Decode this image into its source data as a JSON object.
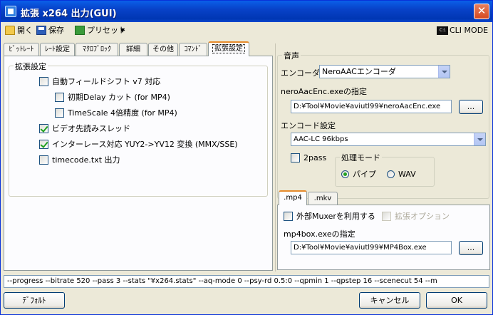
{
  "window": {
    "title": "拡張 x264 出力(GUI)"
  },
  "toolbar": {
    "open_label": "開く",
    "save_label": "保存",
    "preset_label": "プリセット",
    "cli_mode_label": "CLI MODE"
  },
  "tabs": [
    {
      "label": "ﾋﾞｯﾄﾚｰﾄ"
    },
    {
      "label": "ﾚｰﾄ設定"
    },
    {
      "label": "ﾏｸﾛﾌﾞﾛｯｸ"
    },
    {
      "label": "詳細"
    },
    {
      "label": "その他"
    },
    {
      "label": "ｺﾏﾝﾄﾞ"
    },
    {
      "label": "拡張設定"
    }
  ],
  "extended": {
    "group_title": "拡張設定",
    "options": [
      {
        "label": "自動フィールドシフト v7 対応",
        "checked": false
      },
      {
        "label": "初期Delay カット (for MP4)",
        "checked": false
      },
      {
        "label": "TimeScale 4倍精度 (for MP4)",
        "checked": false
      },
      {
        "label": "ビデオ先読みスレッド",
        "checked": true
      },
      {
        "label": "インターレース対応 YUY2->YV12 変換 (MMX/SSE)",
        "checked": true
      },
      {
        "label": "timecode.txt 出力",
        "checked": false
      }
    ]
  },
  "audio": {
    "group_title": "音声",
    "encoder_label": "エンコーダ",
    "encoder_value": "NeroAACエンコーダ",
    "exe_label": "neroAacEnc.exeの指定",
    "exe_path": "D:¥Tool¥Movie¥aviutl99¥neroAacEnc.exe",
    "browse_label": "...",
    "encode_setting_label": "エンコード設定",
    "encode_setting_value": "AAC-LC 96kbps",
    "twopass_label": "2pass",
    "twopass_checked": false,
    "mode_group_title": "処理モード",
    "mode_pipe_label": "パイプ",
    "mode_wav_label": "WAV",
    "mode_selected": "pipe"
  },
  "muxer": {
    "tabs": [
      {
        "label": ".mp4"
      },
      {
        "label": ".mkv"
      }
    ],
    "external_muxer_label": "外部Muxerを利用する",
    "external_muxer_checked": false,
    "extended_option_label": "拡張オプション",
    "exe_label": "mp4box.exeの指定",
    "exe_path": "D:¥Tool¥Movie¥aviutl99¥MP4Box.exe",
    "browse_label": "..."
  },
  "command_line": "--progress --bitrate 520 --pass 3 --stats \"¥x264.stats\" --aq-mode 0 --psy-rd 0.5:0 --qpmin 1 --qpstep 16 --scenecut 54 --m",
  "buttons": {
    "default_label": "ﾃﾞﾌｫﾙﾄ",
    "cancel_label": "キャンセル",
    "ok_label": "OK"
  }
}
